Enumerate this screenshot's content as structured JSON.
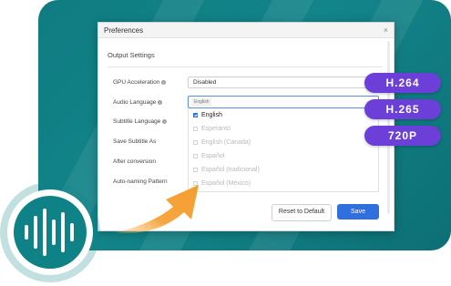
{
  "dialog": {
    "title": "Preferences",
    "close_glyph": "×",
    "section_title": "Output Settings",
    "rows": {
      "gpu_label": "GPU Acceleration",
      "gpu_value": "Disabled",
      "audio_label": "Audio Language",
      "audio_chip": "English",
      "subtitle_label": "Subtitle Language",
      "save_subtitle_label": "Save Subtitle As",
      "after_conversion_label": "After conversion",
      "auto_naming_label": "Auto-naming Pattern"
    },
    "dropdown_options": [
      "English",
      "Esperanto",
      "English (Canada)",
      "Español",
      "Español (tradicional)",
      "Español (México)"
    ],
    "selected_option": "English",
    "reset_label": "Reset to Default",
    "save_label": "Save"
  },
  "badges": [
    "H.264",
    "H.265",
    "720P"
  ],
  "colors": {
    "teal": "#0f7c81",
    "purple": "#6c3fd8",
    "blue_button": "#2f6fe0",
    "orange_arrow": "#f6a640"
  },
  "icons": [
    "info-icon",
    "close-icon",
    "checkbox-icon",
    "arrow-icon",
    "audio-wave-icon"
  ]
}
